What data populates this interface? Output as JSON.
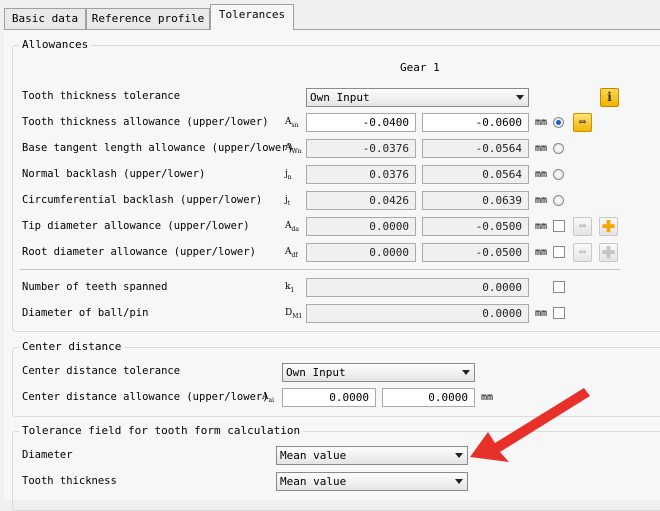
{
  "tabs": [
    {
      "label": "Basic data"
    },
    {
      "label": "Reference profile"
    },
    {
      "label": "Tolerances"
    }
  ],
  "allowances": {
    "group_title": "Allowances",
    "column_header": "Gear 1",
    "tooth_thickness_tolerance": {
      "label": "Tooth thickness tolerance",
      "selected": "Own Input"
    },
    "rows": [
      {
        "label": "Tooth thickness allowance (upper/lower)",
        "symbol": "A",
        "sub": "sn",
        "upper": "-0.0400",
        "lower": "-0.0600",
        "unit": "mm"
      },
      {
        "label": "Base tangent length allowance (upper/lower)",
        "symbol": "A",
        "sub": "Wn",
        "upper": "-0.0376",
        "lower": "-0.0564",
        "unit": "mm"
      },
      {
        "label": "Normal backlash (upper/lower)",
        "symbol": "j",
        "sub": "n",
        "upper": "0.0376",
        "lower": "0.0564",
        "unit": "mm"
      },
      {
        "label": "Circumferential backlash (upper/lower)",
        "symbol": "j",
        "sub": "t",
        "upper": "0.0426",
        "lower": "0.0639",
        "unit": "mm"
      },
      {
        "label": "Tip diameter allowance (upper/lower)",
        "symbol": "A",
        "sub": "da",
        "upper": "0.0000",
        "lower": "-0.0500",
        "unit": "mm"
      },
      {
        "label": "Root diameter allowance (upper/lower)",
        "symbol": "A",
        "sub": "df",
        "upper": "0.0000",
        "lower": "-0.0500",
        "unit": "mm"
      }
    ],
    "teeth_spanned": {
      "label": "Number of teeth spanned",
      "symbol": "k",
      "sub": "1",
      "value": "0.0000"
    },
    "ball_diameter": {
      "label": "Diameter of ball/pin",
      "symbol": "D",
      "sub": "M1",
      "value": "0.0000",
      "unit": "mm"
    }
  },
  "center_distance": {
    "group_title": "Center distance",
    "tolerance": {
      "label": "Center distance tolerance",
      "selected": "Own Input"
    },
    "allowance": {
      "label": "Center distance allowance (upper/lower)",
      "symbol": "A",
      "sub": "ai",
      "upper": "0.0000",
      "lower": "0.0000",
      "unit": "mm"
    }
  },
  "tolerance_field": {
    "group_title": "Tolerance field for tooth form calculation",
    "diameter": {
      "label": "Diameter",
      "selected": "Mean value"
    },
    "tooth_thickness": {
      "label": "Tooth thickness",
      "selected": "Mean value"
    }
  },
  "colors": {
    "arrow": "#e8302a",
    "info_icon": "#f0b400",
    "plus_icon": "#f5a800"
  }
}
